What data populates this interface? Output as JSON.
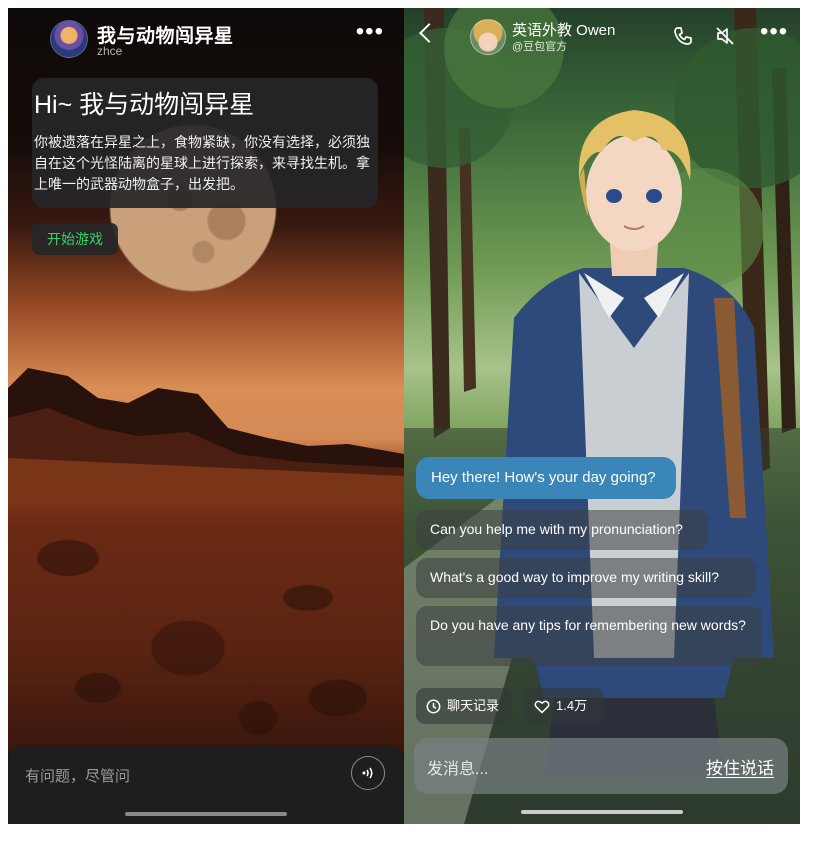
{
  "left_screen": {
    "header": {
      "title": "我与动物闯异星",
      "subtitle": "zhce",
      "more_icon": "more-horizontal-icon"
    },
    "intro": {
      "title": "Hi~ 我与动物闯异星",
      "text": "你被遗落在异星之上，食物紧缺，你没有选择，必须独自在这个光怪陆离的星球上进行探索，来寻找生机。拿上唯一的武器动物盒子，出发把。"
    },
    "start_button": "开始游戏",
    "input": {
      "placeholder": "有问题，尽管问",
      "voice_icon": "voice-wave-icon"
    },
    "colors": {
      "start_text": "#35d36b",
      "card_bg": "#262628"
    }
  },
  "right_screen": {
    "header": {
      "title": "英语外教 Owen",
      "subtitle": "@豆包官方",
      "back_icon": "chevron-left-icon",
      "call_icon": "phone-icon",
      "mute_icon": "speaker-muted-icon",
      "more_icon": "more-horizontal-icon"
    },
    "message": "Hey there! How's your day going?",
    "suggestions": [
      "Can you help me with my pronunciation?",
      "What's a good way to improve my writing skill?",
      "Do you have any tips for remembering new words?"
    ],
    "chips": {
      "history": "聊天记录",
      "likes": "1.4万"
    },
    "input": {
      "placeholder": "发消息...",
      "hold_to_talk": "按住说话"
    },
    "colors": {
      "bubble": "#3a86b8"
    }
  }
}
